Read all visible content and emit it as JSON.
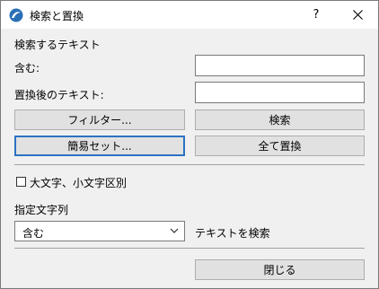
{
  "window": {
    "title": "検索と置換",
    "help_label": "?"
  },
  "search": {
    "section_label": "検索するテキスト",
    "contains_label": "含む:",
    "contains_value": "",
    "replace_label": "置換後のテキスト:",
    "replace_value": ""
  },
  "buttons": {
    "filter": "フィルター...",
    "find": "検索",
    "simple_set": "簡易セット...",
    "replace_all": "全て置換",
    "close": "閉じる"
  },
  "options": {
    "case_sensitive_label": "大文字、小文字区別",
    "case_sensitive_checked": false
  },
  "match": {
    "section_label": "指定文字列",
    "selected": "含む",
    "suffix_label": "テキストを検索"
  },
  "colors": {
    "accent": "#2b72c4",
    "dialog_bg": "#f0f0f0",
    "button_bg": "#e1e1e1"
  }
}
